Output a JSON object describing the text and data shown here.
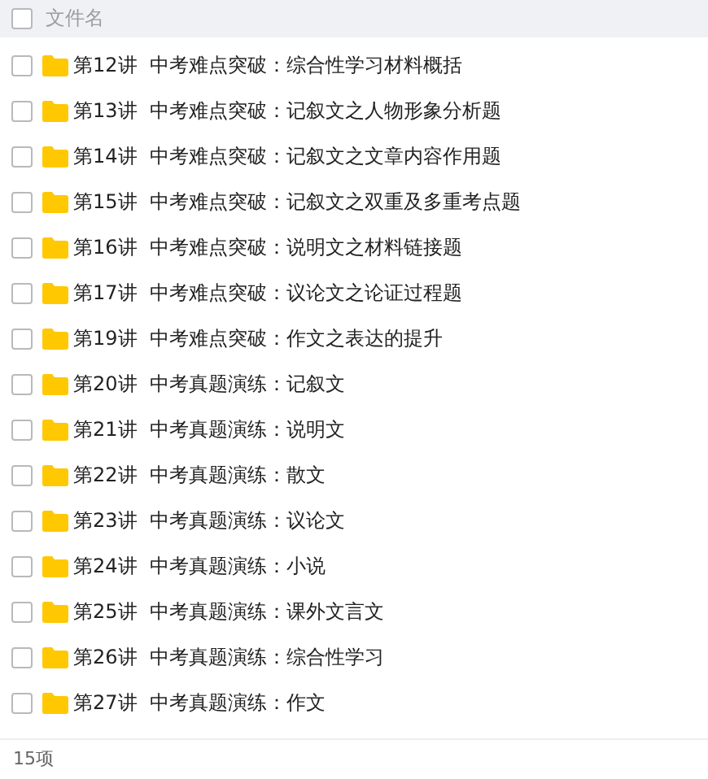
{
  "header": {
    "checked": false,
    "label": "文件名"
  },
  "files": [
    {
      "name": "第12讲  中考难点突破：综合性学习材料概括",
      "checked": false
    },
    {
      "name": "第13讲  中考难点突破：记叙文之人物形象分析题",
      "checked": false
    },
    {
      "name": "第14讲  中考难点突破：记叙文之文章内容作用题",
      "checked": false
    },
    {
      "name": "第15讲  中考难点突破：记叙文之双重及多重考点题",
      "checked": false
    },
    {
      "name": "第16讲  中考难点突破：说明文之材料链接题",
      "checked": false
    },
    {
      "name": "第17讲  中考难点突破：议论文之论证过程题",
      "checked": false
    },
    {
      "name": "第19讲  中考难点突破：作文之表达的提升",
      "checked": false
    },
    {
      "name": "第20讲  中考真题演练：记叙文",
      "checked": false
    },
    {
      "name": "第21讲  中考真题演练：说明文",
      "checked": false
    },
    {
      "name": "第22讲  中考真题演练：散文",
      "checked": false
    },
    {
      "name": "第23讲  中考真题演练：议论文",
      "checked": false
    },
    {
      "name": "第24讲  中考真题演练：小说",
      "checked": false
    },
    {
      "name": "第25讲  中考真题演练：课外文言文",
      "checked": false
    },
    {
      "name": "第26讲  中考真题演练：综合性学习",
      "checked": false
    },
    {
      "name": "第27讲  中考真题演练：作文",
      "checked": false
    }
  ],
  "status_bar": {
    "count": "15项"
  }
}
